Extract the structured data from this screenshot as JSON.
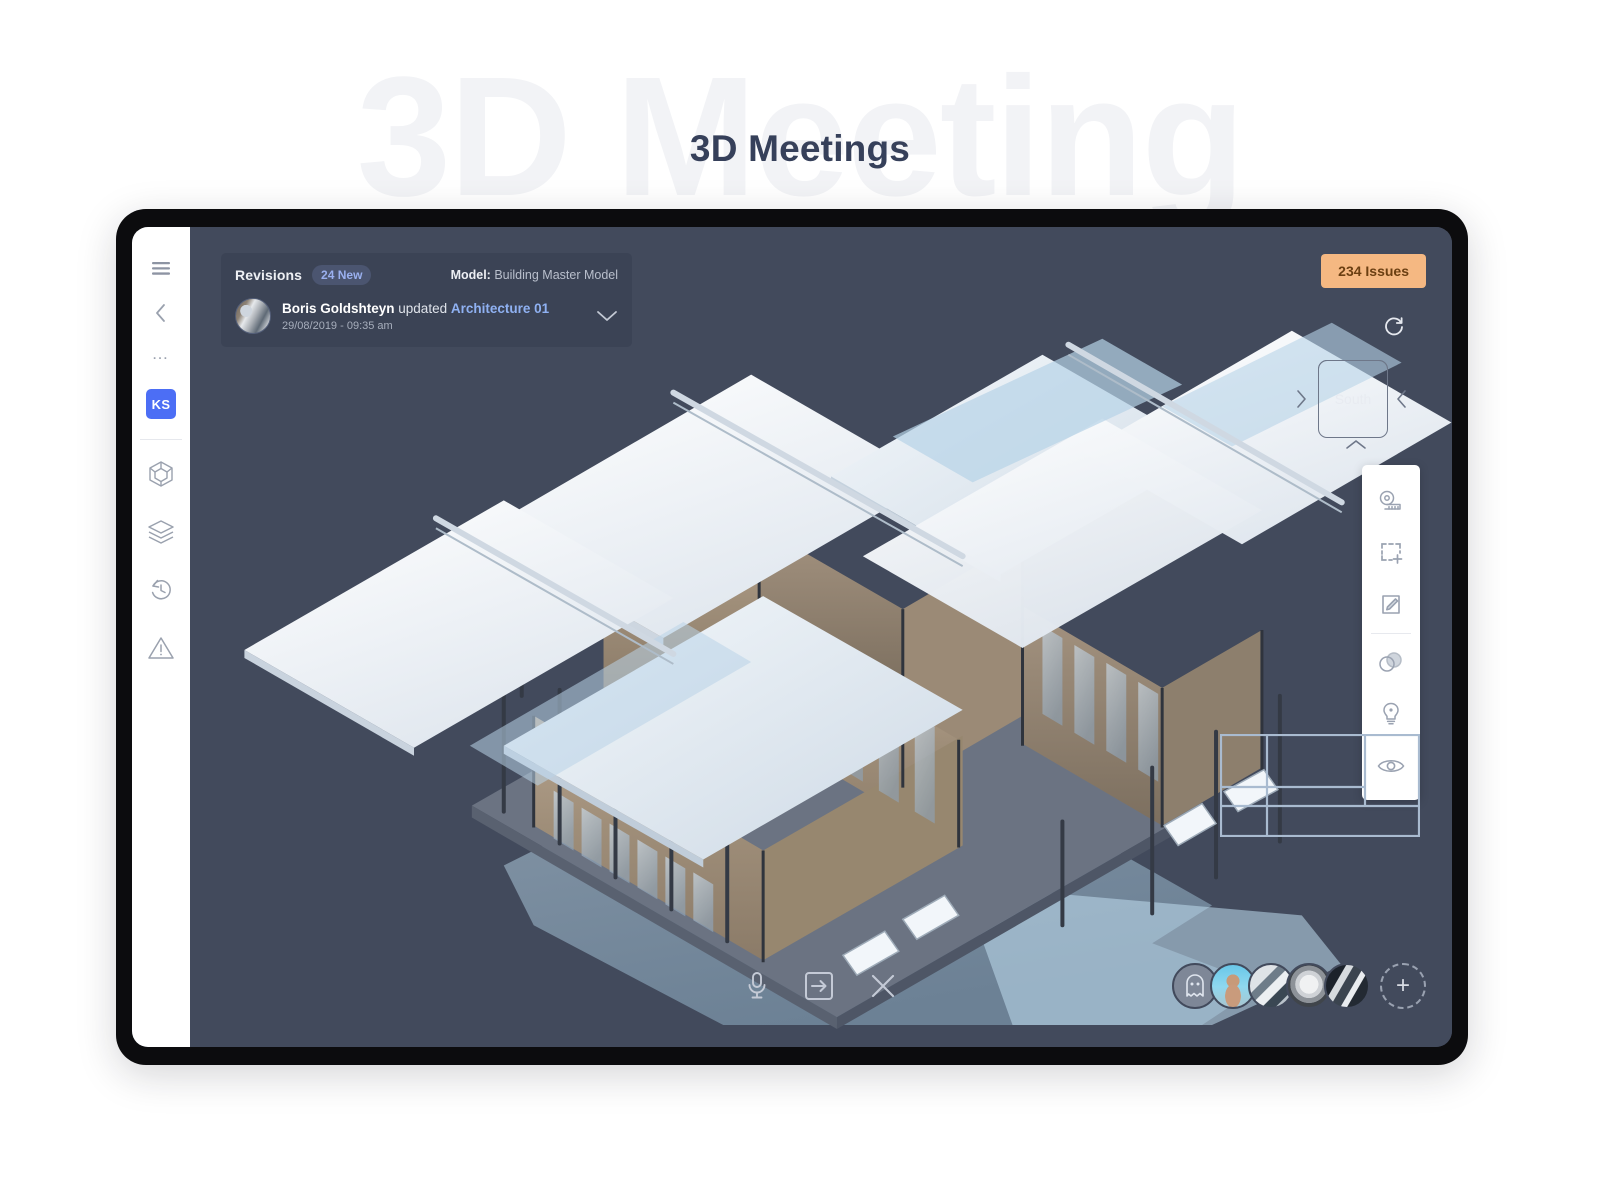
{
  "page": {
    "title": "3D Meetings",
    "watermark": "3D Meeting"
  },
  "sidebar": {
    "items": [
      {
        "name": "menu",
        "icon": "hamburger-icon",
        "label": ""
      },
      {
        "name": "collapse",
        "icon": "chevron-left-icon",
        "label": ""
      },
      {
        "name": "more",
        "icon": "more-dots-icon",
        "label": "…"
      },
      {
        "name": "user",
        "icon": "user-initials-badge",
        "label": "KS"
      },
      {
        "name": "model",
        "icon": "cube-icon",
        "label": ""
      },
      {
        "name": "layers",
        "icon": "layers-icon",
        "label": ""
      },
      {
        "name": "history",
        "icon": "history-clock-icon",
        "label": ""
      },
      {
        "name": "issues",
        "icon": "warning-triangle-icon",
        "label": ""
      }
    ]
  },
  "revisions": {
    "title": "Revisions",
    "badge": "24 New",
    "model_label": "Model:",
    "model_name": "Building Master Model",
    "entry": {
      "author": "Boris Goldshteyn",
      "action": "updated",
      "target": "Architecture 01",
      "timestamp": "29/08/2019 - 09:35 am"
    },
    "expand_icon": "chevron-down-icon"
  },
  "issues_badge": {
    "label": "234 Issues",
    "color": "#f5b882",
    "text_color": "#6b3f12"
  },
  "viewcube": {
    "face": "South",
    "rotate_icon": "refresh-icon",
    "left_arrow": "chevron-left-icon",
    "right_arrow": "chevron-right-icon",
    "bottom_arrow": "chevron-up-icon"
  },
  "right_toolbar": {
    "tools": [
      {
        "name": "measure-tape-icon",
        "label": "Measure"
      },
      {
        "name": "section-box-icon",
        "label": "Section Box"
      },
      {
        "name": "markup-pencil-icon",
        "label": "Markup"
      },
      {
        "name": "transparency-icon",
        "label": "Transparency"
      },
      {
        "name": "lightbulb-icon",
        "label": "Lighting"
      },
      {
        "name": "eye-icon",
        "label": "Visibility"
      }
    ]
  },
  "bottom_controls": [
    {
      "name": "microphone-icon",
      "label": "Mute"
    },
    {
      "name": "enter-room-icon",
      "label": "Join"
    },
    {
      "name": "close-icon",
      "label": "End"
    }
  ],
  "participants": [
    {
      "name": "participant-ghost",
      "label": "Anonymous"
    },
    {
      "name": "participant-2",
      "label": "Participant 2"
    },
    {
      "name": "participant-3",
      "label": "Participant 3"
    },
    {
      "name": "participant-4",
      "label": "Participant 4"
    },
    {
      "name": "participant-5",
      "label": "Participant 5"
    }
  ],
  "add_participant": {
    "icon": "plus-icon",
    "label": "+"
  },
  "colors": {
    "canvas_bg": "#424a5c",
    "panel_bg": "#3b4355",
    "accent_blue": "#4c6ef5",
    "link_blue": "#8fb1f2",
    "issues_orange": "#f5b882",
    "rail_bg": "#ffffff",
    "title_text": "#36405a"
  }
}
